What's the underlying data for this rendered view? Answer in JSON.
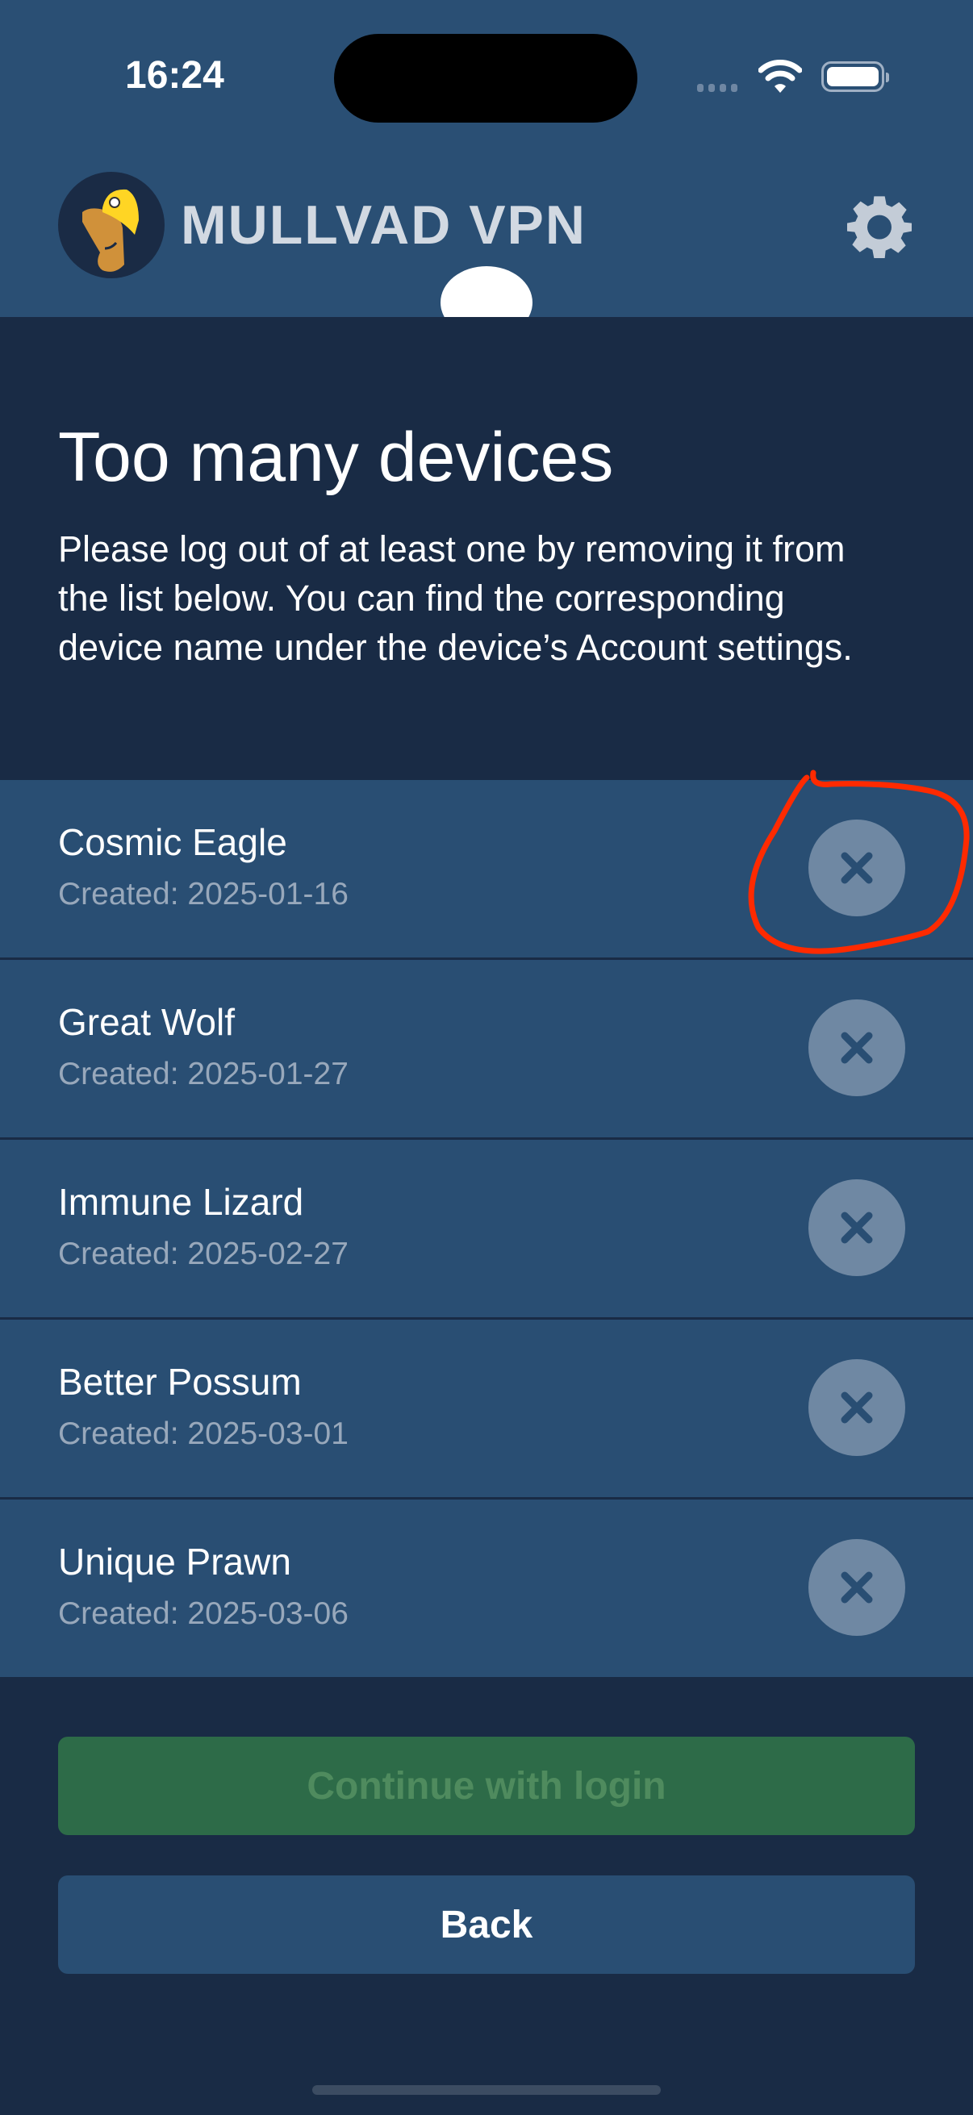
{
  "status_bar": {
    "time": "16:24"
  },
  "header": {
    "brand": "MULLVAD VPN",
    "settings_icon": "gear-icon"
  },
  "main": {
    "title": "Too many devices",
    "description": "Please log out of at least one by removing it from the list below. You can find the corresponding device name under the device’s Account settings."
  },
  "devices": [
    {
      "name": "Cosmic Eagle",
      "created": "Created: 2025-01-16"
    },
    {
      "name": "Great Wolf",
      "created": "Created: 2025-01-27"
    },
    {
      "name": "Immune Lizard",
      "created": "Created: 2025-02-27"
    },
    {
      "name": "Better Possum",
      "created": "Created: 2025-03-01"
    },
    {
      "name": "Unique Prawn",
      "created": "Created: 2025-03-06"
    }
  ],
  "buttons": {
    "continue": "Continue with login",
    "back": "Back"
  },
  "colors": {
    "header": "#2a4f74",
    "background": "#192b45",
    "continue": "#2d6b48",
    "annotation": "#ff2a00"
  }
}
